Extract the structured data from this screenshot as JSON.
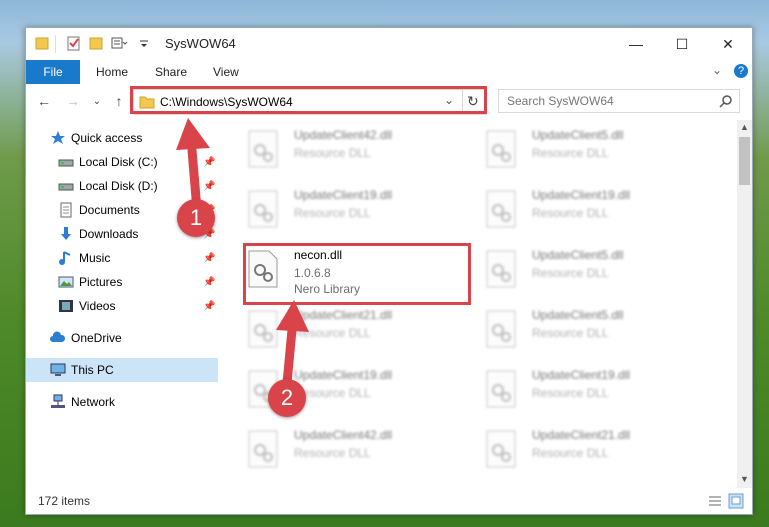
{
  "window": {
    "title": "SysWOW64",
    "controls": {
      "minimize": "—",
      "maximize": "☐",
      "close": "✕"
    }
  },
  "ribbon": {
    "tabs": [
      "File",
      "Home",
      "Share",
      "View"
    ],
    "expand_glyph": "⌄",
    "help_glyph": "?"
  },
  "address": {
    "path": "C:\\Windows\\SysWOW64",
    "dropdown_glyph": "⌄",
    "refresh_glyph": "↻"
  },
  "search": {
    "placeholder": "Search SysWOW64"
  },
  "nav": {
    "quick_access": "Quick access",
    "items": [
      {
        "label": "Local Disk (C:)",
        "pinned": true
      },
      {
        "label": "Local Disk (D:)",
        "pinned": true
      },
      {
        "label": "Documents",
        "pinned": true
      },
      {
        "label": "Downloads",
        "pinned": true
      },
      {
        "label": "Music",
        "pinned": true
      },
      {
        "label": "Pictures",
        "pinned": true
      },
      {
        "label": "Videos",
        "pinned": true
      }
    ],
    "onedrive": "OneDrive",
    "this_pc": "This PC",
    "network": "Network"
  },
  "files": {
    "highlighted": {
      "name": "necon.dll",
      "version": "1.0.6.8",
      "description": "Nero Library"
    },
    "blurred_left": [
      {
        "name": "UpdateClient42.dll",
        "description": "Resource DLL"
      },
      {
        "name": "UpdateClient19.dll",
        "description": "Resource DLL"
      },
      {
        "name": "UpdateClient21.dll",
        "description": "Resource DLL"
      },
      {
        "name": "UpdateClient19.dll",
        "description": "Resource DLL"
      },
      {
        "name": "UpdateClient42.dll",
        "description": "Resource DLL"
      }
    ],
    "blurred_right": [
      {
        "name": "UpdateClient5.dll",
        "description": "Resource DLL"
      },
      {
        "name": "UpdateClient19.dll",
        "description": "Resource DLL"
      },
      {
        "name": "UpdateClient5.dll",
        "description": "Resource DLL"
      },
      {
        "name": "UpdateClient5.dll",
        "description": "Resource DLL"
      },
      {
        "name": "UpdateClient19.dll",
        "description": "Resource DLL"
      },
      {
        "name": "UpdateClient21.dll",
        "description": "Resource DLL"
      }
    ]
  },
  "status": {
    "item_count": "172 items"
  },
  "callouts": {
    "one": "1",
    "two": "2"
  },
  "colors": {
    "accent": "#1979ca",
    "highlight": "#d9434a",
    "selection": "#cce4f7"
  }
}
